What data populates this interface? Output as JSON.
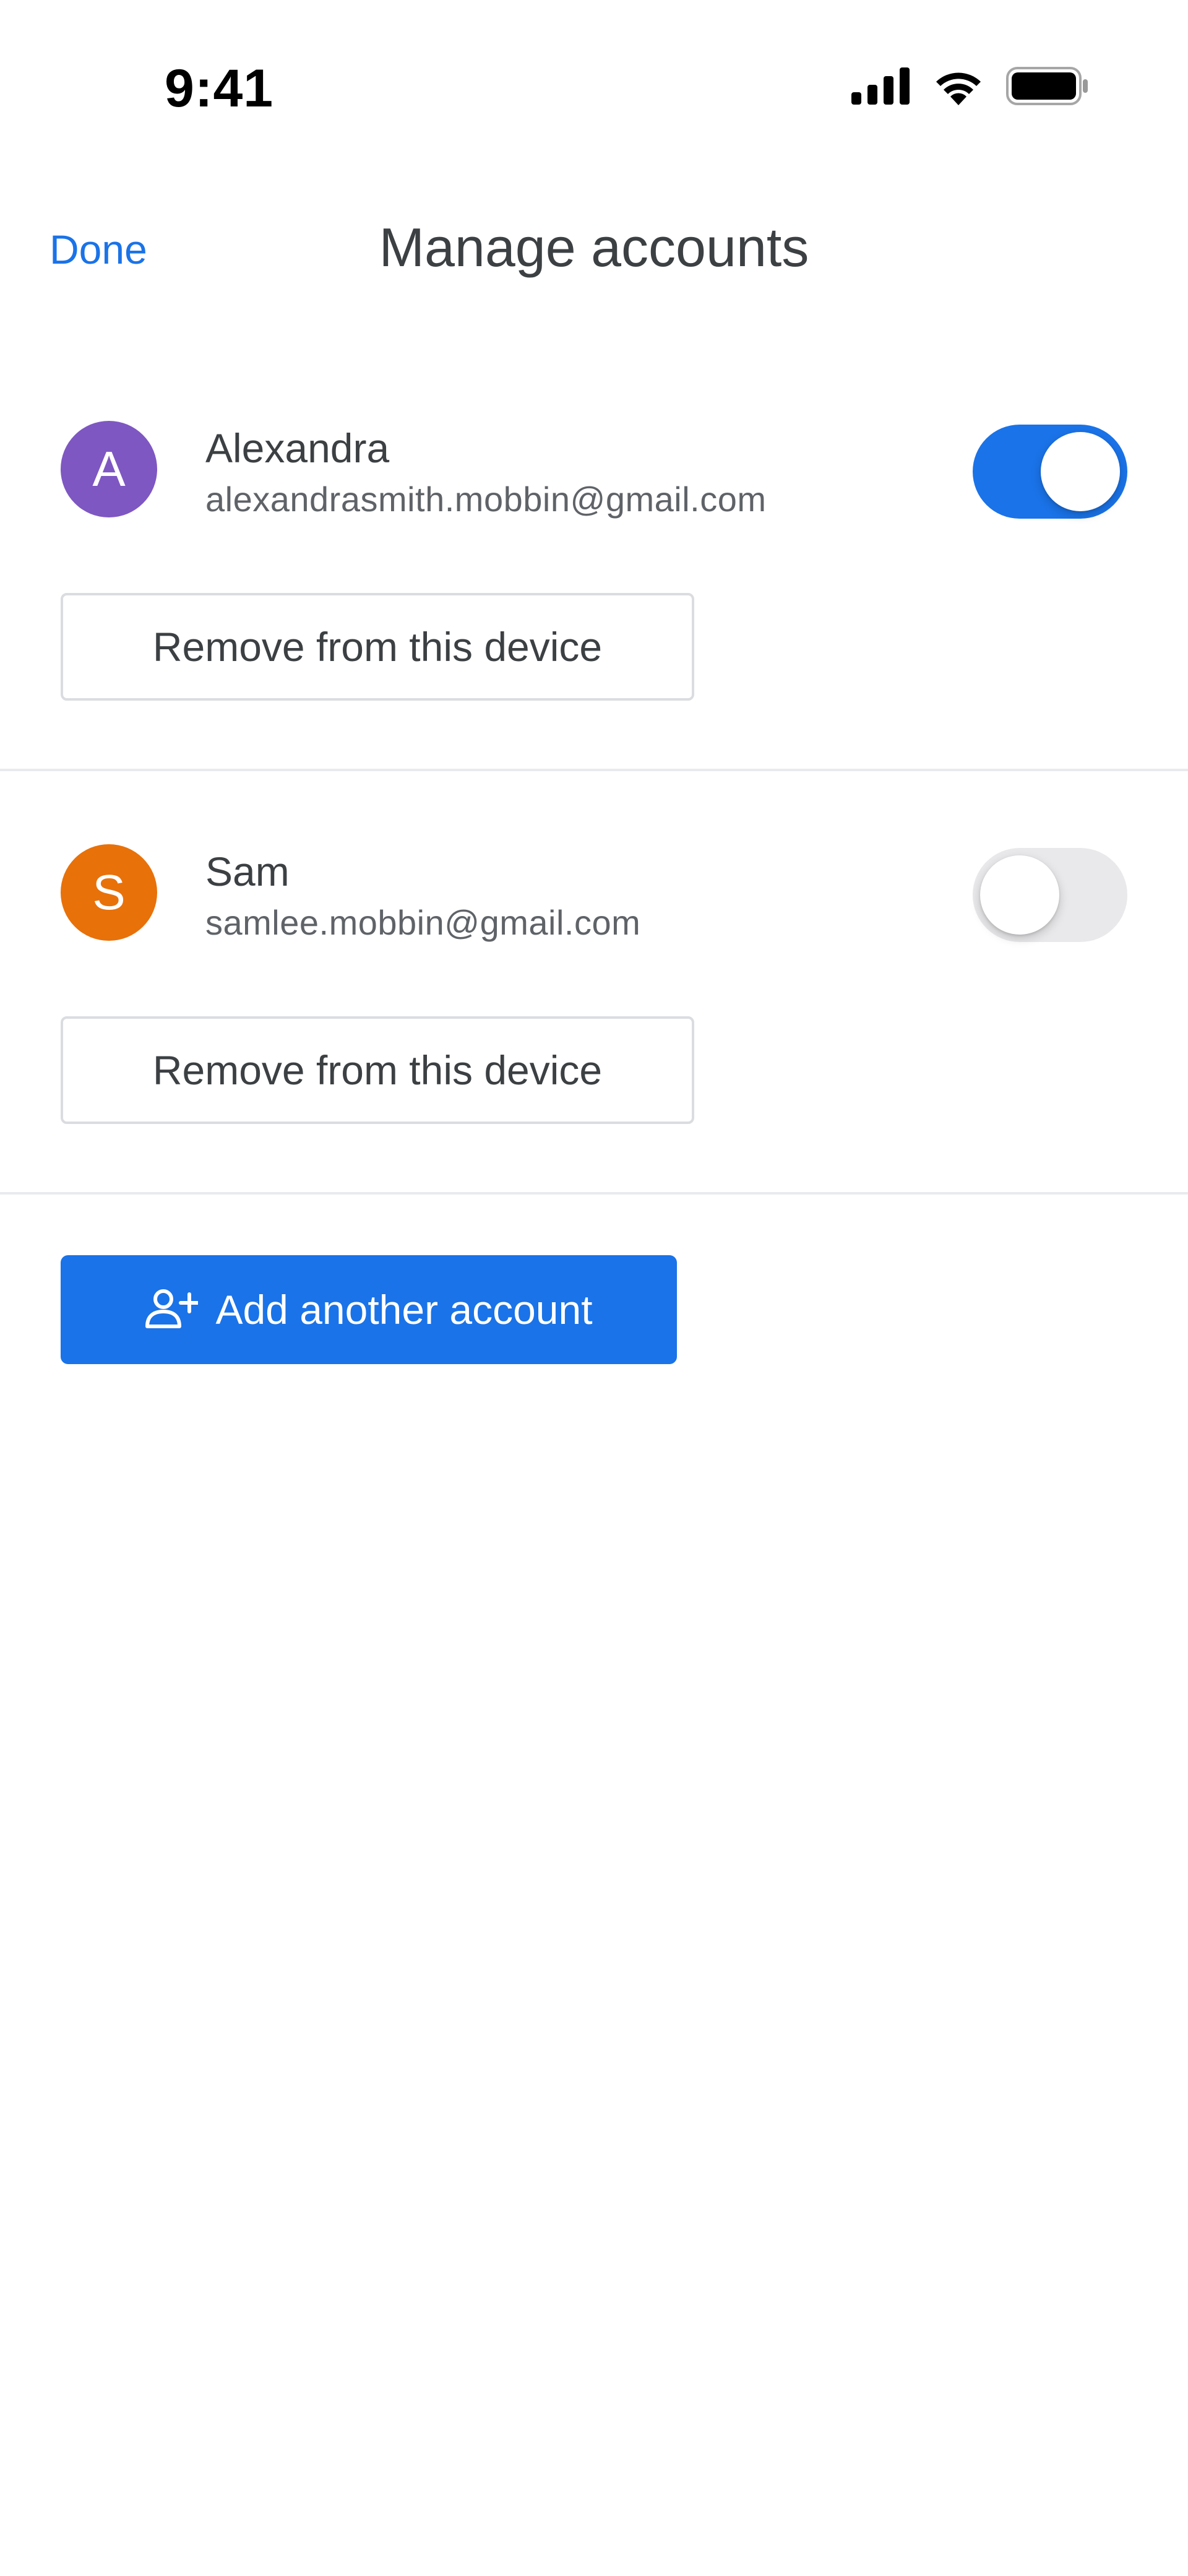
{
  "status_bar": {
    "time": "9:41",
    "icons": [
      "cellular-signal-icon",
      "wifi-icon",
      "battery-icon"
    ]
  },
  "header": {
    "done_label": "Done",
    "title": "Manage accounts"
  },
  "accounts": [
    {
      "initial": "A",
      "name": "Alexandra",
      "email": "alexandrasmith.mobbin@gmail.com",
      "avatar_color": "#7e57c2",
      "enabled": true,
      "remove_label": "Remove from this device"
    },
    {
      "initial": "S",
      "name": "Sam",
      "email": "samlee.mobbin@gmail.com",
      "avatar_color": "#e8710a",
      "enabled": false,
      "remove_label": "Remove from this device"
    }
  ],
  "add_account": {
    "label": "Add another account",
    "icon": "add-person-icon"
  },
  "colors": {
    "accent": "#1a73e8",
    "toggle_off": "#e9e9eb",
    "text_primary": "#3c4043",
    "text_secondary": "#5f6368",
    "divider": "#e8eaed"
  }
}
